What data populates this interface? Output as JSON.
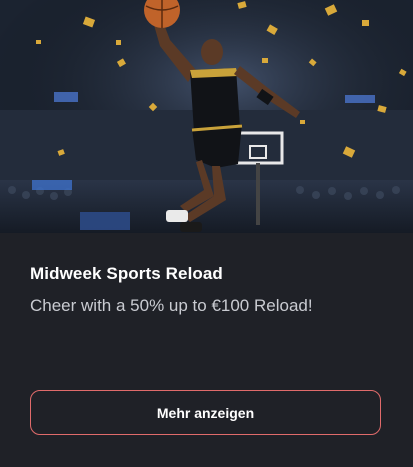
{
  "promo": {
    "title": "Midweek Sports Reload",
    "description": "Cheer with a 50% up to €100 Reload!",
    "button_label": "Mehr anzeigen",
    "accent_color": "#e06b6b",
    "hero_image": "basketball-player-dunk-illustration"
  }
}
